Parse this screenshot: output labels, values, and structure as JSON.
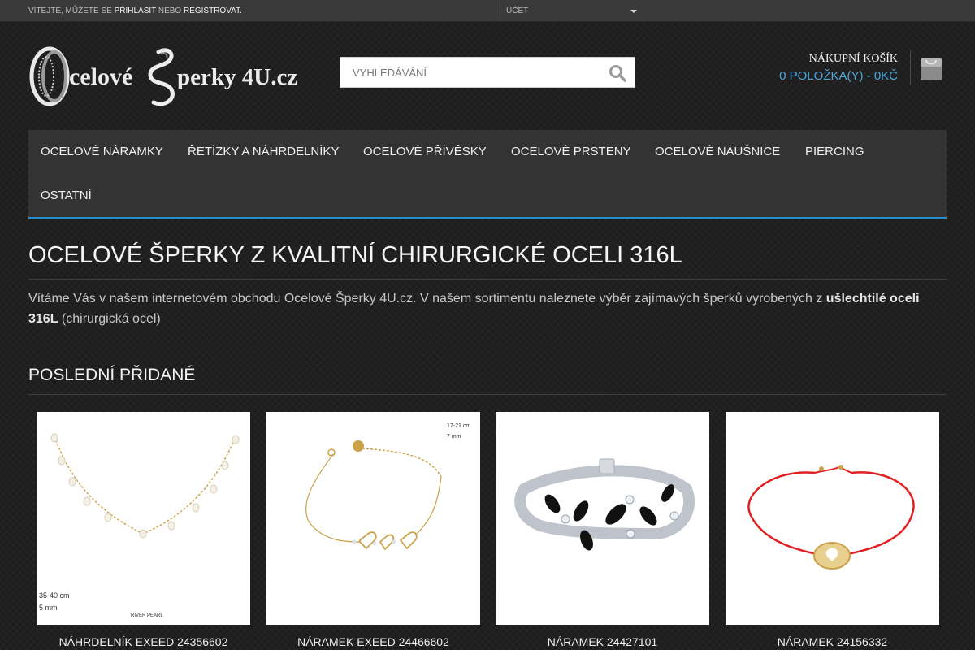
{
  "topbar": {
    "welcome_prefix": "Vítejte, můžete se",
    "login_link": "přihlásit",
    "or_text": "nebo",
    "register_link": "registrovat."
  },
  "account": {
    "label": "Účet"
  },
  "logo": {
    "alt": "Ocelové Šperky 4U.cz"
  },
  "search": {
    "placeholder": "VYHLEDÁVÁNÍ",
    "icon": "search-icon"
  },
  "cart": {
    "title": "Nákupní košík",
    "summary": "0 položka(y) - 0Kč",
    "icon": "shopping-bag-icon"
  },
  "nav": {
    "items": [
      "Ocelové náramky",
      "Řetízky a náhrdelníky",
      "Ocelové přívěsky",
      "Ocelové prsteny",
      "Ocelové náušnice",
      "Piercing",
      "Ostatní"
    ]
  },
  "main": {
    "title": "Ocelové šperky z kvalitní chirurgické oceli 316L",
    "intro_text": "Vítáme Vás v našem internetovém obchodu Ocelové Šperky 4U.cz. V našem sortimentu naleznete výběr zajímavých šperků vyrobených z",
    "intro_bold": "ušlechtilé oceli 316L",
    "intro_suffix": "(chirurgická ocel)"
  },
  "latest": {
    "title": "Poslední přidané",
    "products": [
      {
        "name": "Náhrdelník EXEED 24356602",
        "img_size": "35-40 cm",
        "img_width": "5 mm",
        "img_caption": "RIVER PEARL"
      },
      {
        "name": "Náramek EXEED 24466602",
        "img_size": "17-21 cm",
        "img_width": "7 mm"
      },
      {
        "name": "Náramek 24427101"
      },
      {
        "name": "Náramek 24156332"
      }
    ]
  },
  "colors": {
    "accent": "#2a8dcb",
    "cart_link": "#4aa8dd",
    "background": "#202020",
    "nav_bg": "#333333"
  }
}
